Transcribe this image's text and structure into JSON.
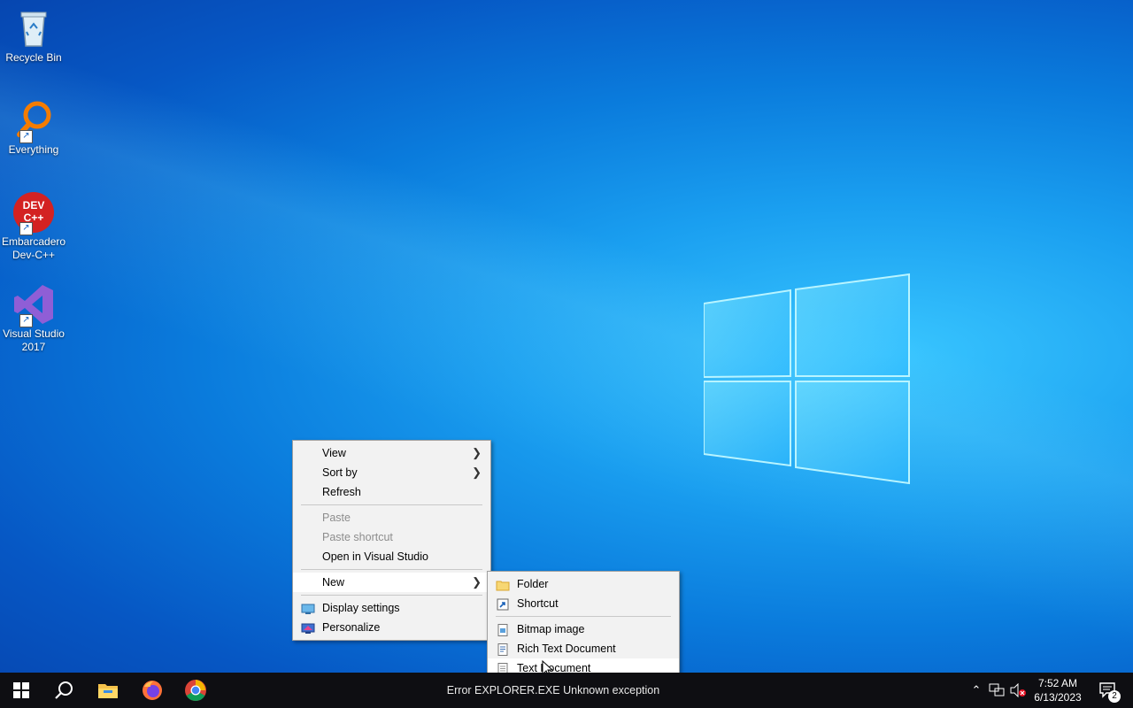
{
  "desktop": {
    "icons": [
      {
        "label": "Recycle Bin"
      },
      {
        "label": "Everything"
      },
      {
        "label": "Embarcadero Dev-C++"
      },
      {
        "label": "Visual Studio 2017"
      }
    ],
    "devcpp_icon_text": "DEV C++"
  },
  "context_menu": {
    "view": "View",
    "sort_by": "Sort by",
    "refresh": "Refresh",
    "paste": "Paste",
    "paste_shortcut": "Paste shortcut",
    "open_in_vs": "Open in Visual Studio",
    "new": "New",
    "display_settings": "Display settings",
    "personalize": "Personalize"
  },
  "new_submenu": {
    "folder": "Folder",
    "shortcut": "Shortcut",
    "bitmap_image": "Bitmap image",
    "rich_text_document": "Rich Text Document",
    "text_document": "Text Document"
  },
  "taskbar": {
    "status_text": "Error EXPLORER.EXE Unknown exception",
    "time": "7:52 AM",
    "date": "6/13/2023",
    "notification_count": "2"
  },
  "colors": {
    "taskbar_bg": "#0e0e12",
    "menu_bg": "#f2f2f2",
    "desktop_blue": "#0a7bdc"
  }
}
